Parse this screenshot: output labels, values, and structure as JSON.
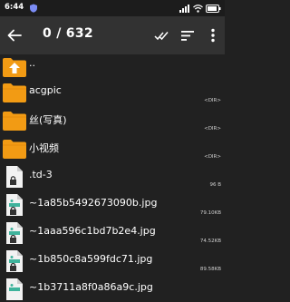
{
  "status": {
    "time": "6:44",
    "battery": "79"
  },
  "toolbar": {
    "title": "0 / 632"
  },
  "items": [
    {
      "name": "..",
      "meta": "",
      "kind": "up"
    },
    {
      "name": "acgpic",
      "meta": "<DIR>",
      "kind": "folder"
    },
    {
      "name": "丝(写真)",
      "meta": "<DIR>",
      "kind": "folder"
    },
    {
      "name": "小视频",
      "meta": "<DIR>",
      "kind": "folder"
    },
    {
      "name": ".td-3",
      "meta": "96 B",
      "kind": "file-locked"
    },
    {
      "name": "~1a85b5492673090b.jpg",
      "meta": "79.10KB",
      "kind": "image-locked"
    },
    {
      "name": "~1aaa596c1bd7b2e4.jpg",
      "meta": "74.52KB",
      "kind": "image-locked"
    },
    {
      "name": "~1b850c8a599fdc71.jpg",
      "meta": "89.58KB",
      "kind": "image-locked"
    },
    {
      "name": "~1b3711a8f0a86a9c.jpg",
      "meta": "",
      "kind": "image-locked"
    }
  ],
  "colors": {
    "folder": "#f29b14",
    "toolbar": "#323232",
    "background": "#212121",
    "image_icon_accent": "#3fb39c"
  },
  "icons": [
    "back-arrow-icon",
    "select-all-icon",
    "sort-icon",
    "more-vert-icon",
    "folder-icon",
    "folder-up-icon",
    "file-icon",
    "image-file-icon",
    "lock-icon"
  ]
}
